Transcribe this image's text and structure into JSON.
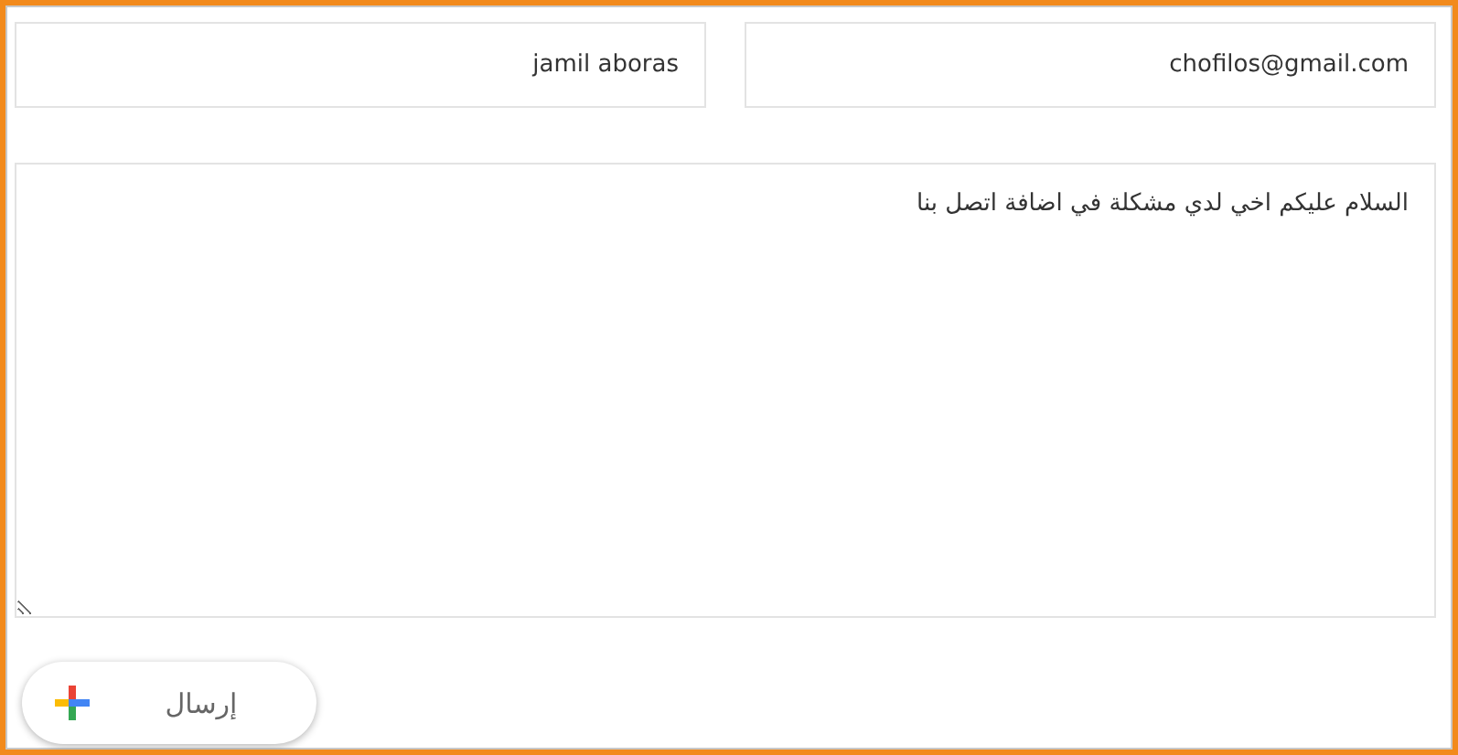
{
  "form": {
    "name_value": "jamil aboras",
    "email_value": "chofilos@gmail.com",
    "message_value": "السلام عليكم اخي لدي مشكلة في اضافة اتصل بنا",
    "submit_label": "إرسال"
  }
}
